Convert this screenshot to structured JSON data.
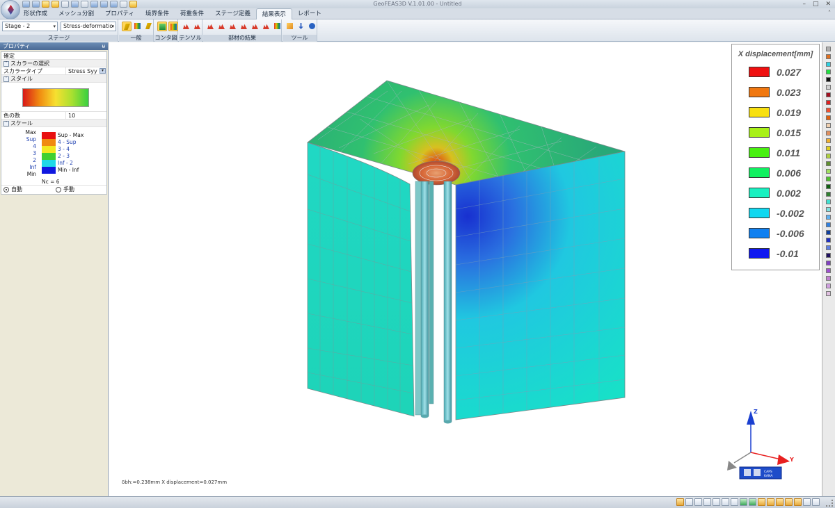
{
  "window": {
    "title": "GeoFEAS3D  V.1.01.00 - Untitled",
    "controls": [
      "–",
      "□",
      "✕"
    ]
  },
  "tabs": [
    {
      "label": "形状作成",
      "active": false
    },
    {
      "label": "メッシュ分割",
      "active": false
    },
    {
      "label": "プロパティ",
      "active": false
    },
    {
      "label": "境界条件",
      "active": false
    },
    {
      "label": "荷重条件",
      "active": false
    },
    {
      "label": "ステージ定義",
      "active": false
    },
    {
      "label": "結果表示",
      "active": true
    },
    {
      "label": "レポート",
      "active": false
    }
  ],
  "ribbon": {
    "stage_combo": "Stage - 2",
    "result_combo": "Stress-deformatio",
    "groups": {
      "stage": "ステージ",
      "general": "一般",
      "contour": "コンタ図",
      "tensor": "テンソル",
      "member_results": "部材の結果",
      "tools": "ツール"
    }
  },
  "panel": {
    "title": "プロパティ",
    "pin": "ᵾ",
    "confirm": "確定",
    "scalar_category": "スカラーの選択",
    "scalar_type_label": "スカラータイプ",
    "scalar_type_value": "Stress Syy",
    "style_category": "スタイル",
    "color_count_label": "色の数",
    "color_count_value": "10",
    "scale_category": "スケール",
    "scale_rows": [
      {
        "left": "Max",
        "range": "Sup - Max",
        "color": "#e81010"
      },
      {
        "left": "Sup",
        "range": "4 - Sup",
        "color": "#f08a10"
      },
      {
        "left": "4",
        "range": "3 - 4",
        "color": "#f2e820"
      },
      {
        "left": "3",
        "range": "2 - 3",
        "color": "#40d030"
      },
      {
        "left": "2",
        "range": "Inf - 2",
        "color": "#20d8e8"
      },
      {
        "left": "Inf",
        "range": "Min - Inf",
        "color": "#1018e0"
      },
      {
        "left": "Min",
        "range": "",
        "color": ""
      }
    ],
    "nc_label": "Nc = 6",
    "mode_auto": "自動",
    "mode_manual": "手動",
    "mode_selected": "auto"
  },
  "legend": {
    "title": "X displacement[mm]",
    "entries": [
      {
        "value": "0.027",
        "color": "#f01010"
      },
      {
        "value": "0.023",
        "color": "#f07810"
      },
      {
        "value": "0.019",
        "color": "#f8e010"
      },
      {
        "value": "0.015",
        "color": "#a8f018"
      },
      {
        "value": "0.011",
        "color": "#48f010"
      },
      {
        "value": "0.006",
        "color": "#10f060"
      },
      {
        "value": "0.002",
        "color": "#18f0c0"
      },
      {
        "value": "-0.002",
        "color": "#10d8f0"
      },
      {
        "value": "-0.006",
        "color": "#1080f0"
      },
      {
        "value": "-0.01",
        "color": "#1018f0"
      }
    ]
  },
  "status_text": "δbh:=0.238mm  X displacement=0.027mm",
  "axes": {
    "z": "Z",
    "y": "Y"
  },
  "nav_widget": {
    "line1": "CAPS",
    "line2": "KANA"
  },
  "palette_colors": [
    "#b0b0b0",
    "#e07020",
    "#30d0e0",
    "#20e040",
    "#101010",
    "#d0d0d0",
    "#a01020",
    "#e02020",
    "#f05030",
    "#e06010",
    "#f0d0b0",
    "#e09060",
    "#f0b030",
    "#e0d020",
    "#b0d040",
    "#609030",
    "#a0e060",
    "#50c030",
    "#106010",
    "#308030",
    "#40e0d0",
    "#80e0e0",
    "#60b0f0",
    "#3080e0",
    "#1040a0",
    "#2030c0",
    "#6080e0",
    "#201060",
    "#8040c0",
    "#a050d0",
    "#c080d0",
    "#d0a0e0",
    "#e0c0e0"
  ]
}
